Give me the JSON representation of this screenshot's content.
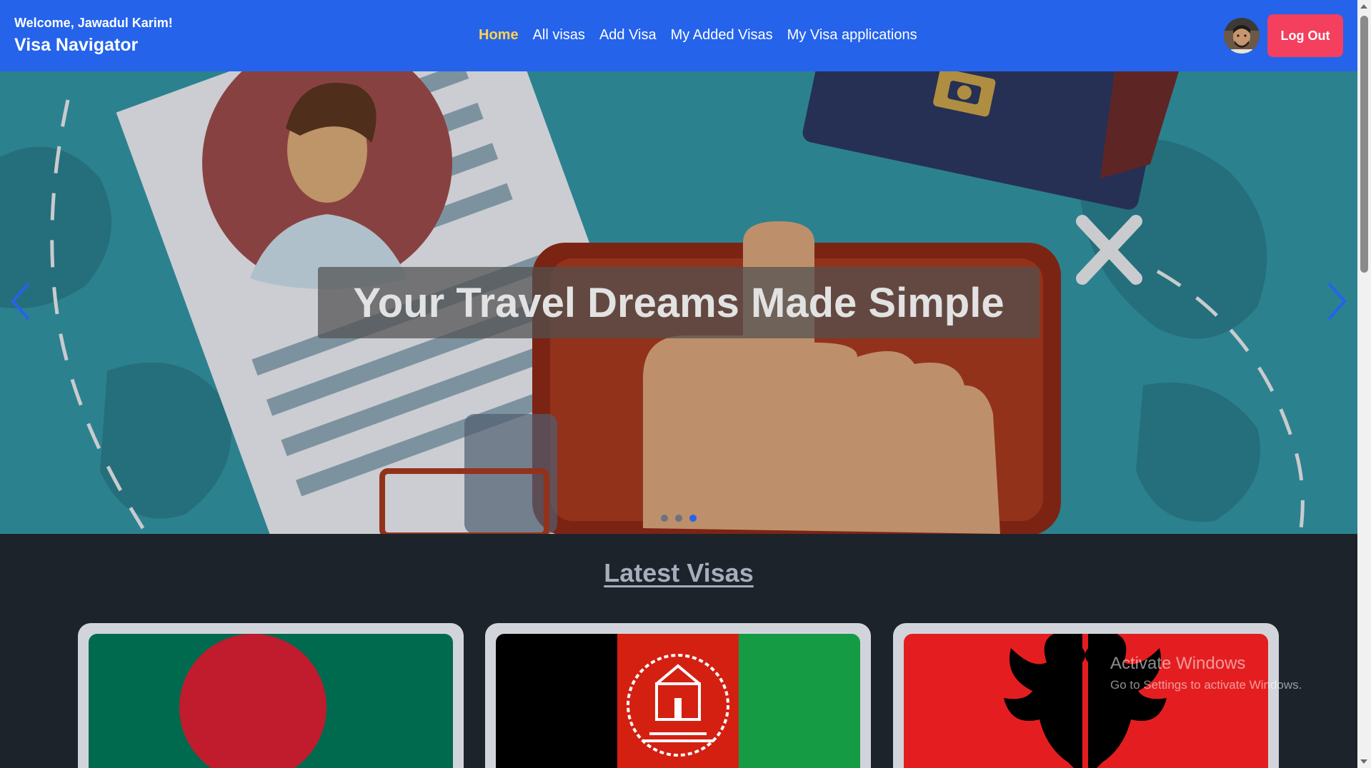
{
  "navbar": {
    "welcome": "Welcome, Jawadul Karim!",
    "brand": "Visa Navigator",
    "links": [
      "Home",
      "All visas",
      "Add Visa",
      "My Added Visas",
      "My Visa applications"
    ],
    "active_link": "Home",
    "logout_label": "Log Out",
    "colors": {
      "background": "#2563eb",
      "active": "#fcd34d",
      "logout": "#f43f5e"
    }
  },
  "hero": {
    "caption": "Your Travel Dreams Made Simple",
    "slide_count": 3,
    "active_slide": 3,
    "prev_icon": "chevron-left-icon",
    "next_icon": "chevron-right-icon"
  },
  "latest_visas": {
    "title": "Latest Visas",
    "cards": [
      {
        "flag": "Bangladesh"
      },
      {
        "flag": "Afghanistan"
      },
      {
        "flag": "Albania"
      }
    ]
  },
  "watermark": {
    "line1": "Activate Windows",
    "line2": "Go to Settings to activate Windows."
  }
}
